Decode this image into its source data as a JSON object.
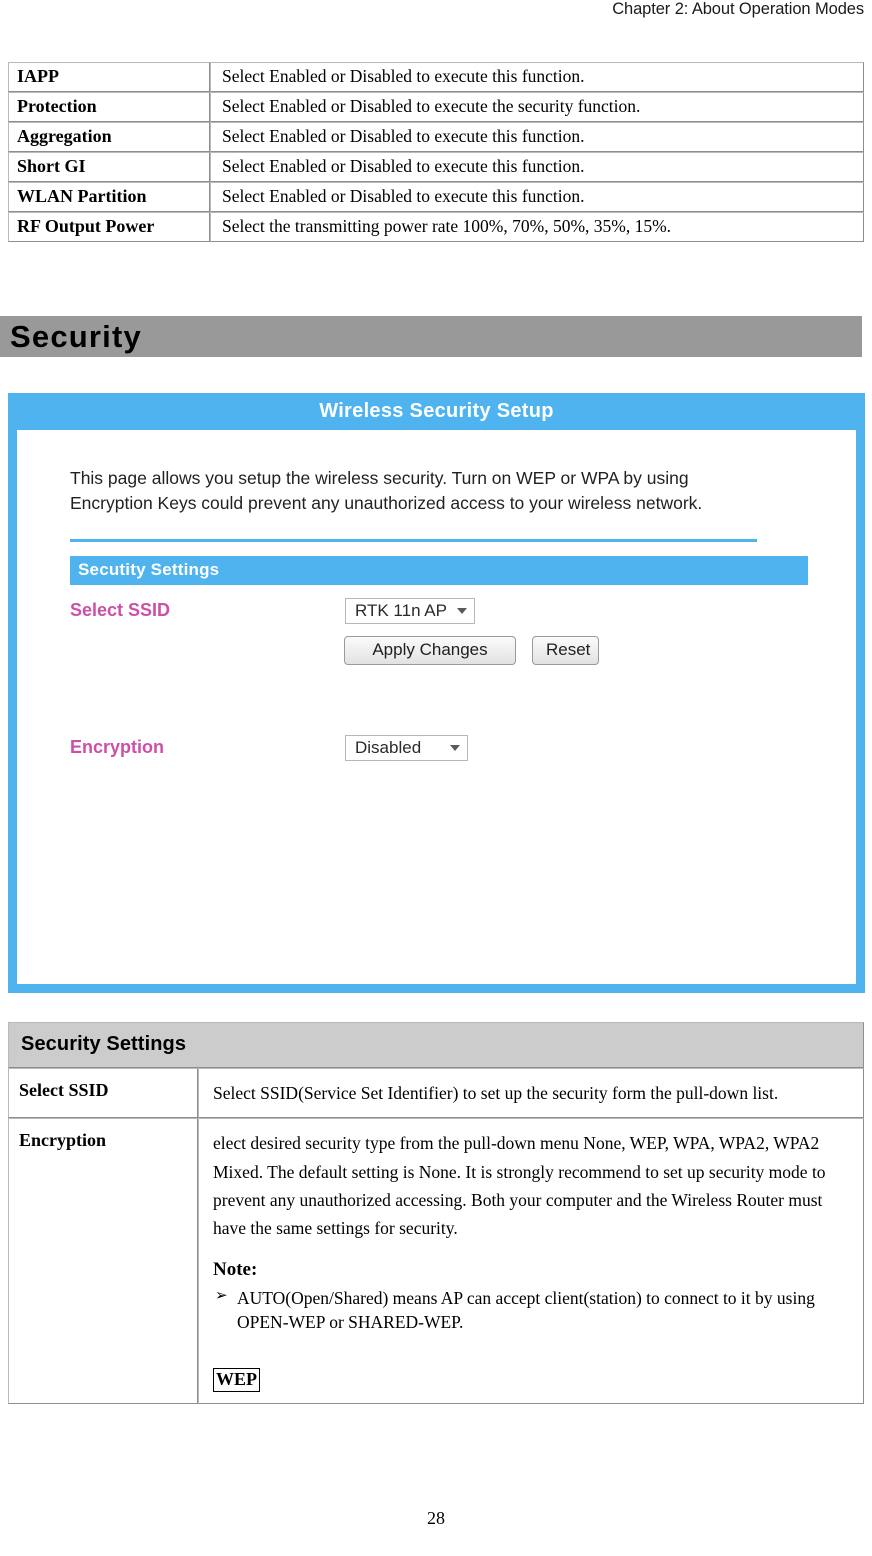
{
  "header": {
    "running_head": "Chapter 2: About Operation Modes"
  },
  "top_table": {
    "rows": [
      {
        "label": "IAPP",
        "desc": "Select Enabled or Disabled to execute this function."
      },
      {
        "label": "Protection",
        "desc": "Select Enabled or Disabled to execute the security function."
      },
      {
        "label": "Aggregation",
        "desc": "Select Enabled or Disabled to execute this function."
      },
      {
        "label": "Short GI",
        "desc": "Select Enabled or Disabled to execute this function."
      },
      {
        "label": "WLAN Partition",
        "desc": "Select Enabled or Disabled to execute this function."
      },
      {
        "label": "RF Output Power",
        "desc": "Select the transmitting power rate 100%, 70%, 50%, 35%, 15%."
      }
    ]
  },
  "section": {
    "title": "Security",
    "bar_color": "#999999"
  },
  "screenshot": {
    "frame_color": "#4eb3ef",
    "title": "Wireless Security Setup",
    "intro": "This page allows you setup the wireless security. Turn on WEP or WPA by using Encryption Keys could prevent any unauthorized access to your wireless network.",
    "sub_bar_label": "Secutity Settings",
    "fields": {
      "ssid_label": "Select SSID",
      "ssid_value": "RTK 11n AP",
      "encryption_label": "Encryption",
      "encryption_value": "Disabled"
    },
    "buttons": {
      "apply": "Apply Changes",
      "reset": "Reset"
    },
    "label_color": "#cc4fa8"
  },
  "bottom_table": {
    "header": "Security Settings",
    "rows": [
      {
        "key": "Select SSID",
        "value": "Select SSID(Service Set Identifier) to set up the security form the pull-down list."
      },
      {
        "key": "Encryption",
        "value": "elect desired security type from the pull-down menu None, WEP, WPA, WPA2, WPA2 Mixed. The default setting is None. It is strongly recommend to set up security mode to prevent any unauthorized accessing. Both your computer and the Wireless Router must have the same settings for security.",
        "note_heading": "Note:",
        "note_bullet_marker": "➢",
        "note_items": [
          "AUTO(Open/Shared) means AP can accept client(station) to connect to it by using OPEN-WEP or SHARED-WEP."
        ],
        "tag": "WEP"
      }
    ]
  },
  "footer": {
    "page_number": "28"
  }
}
